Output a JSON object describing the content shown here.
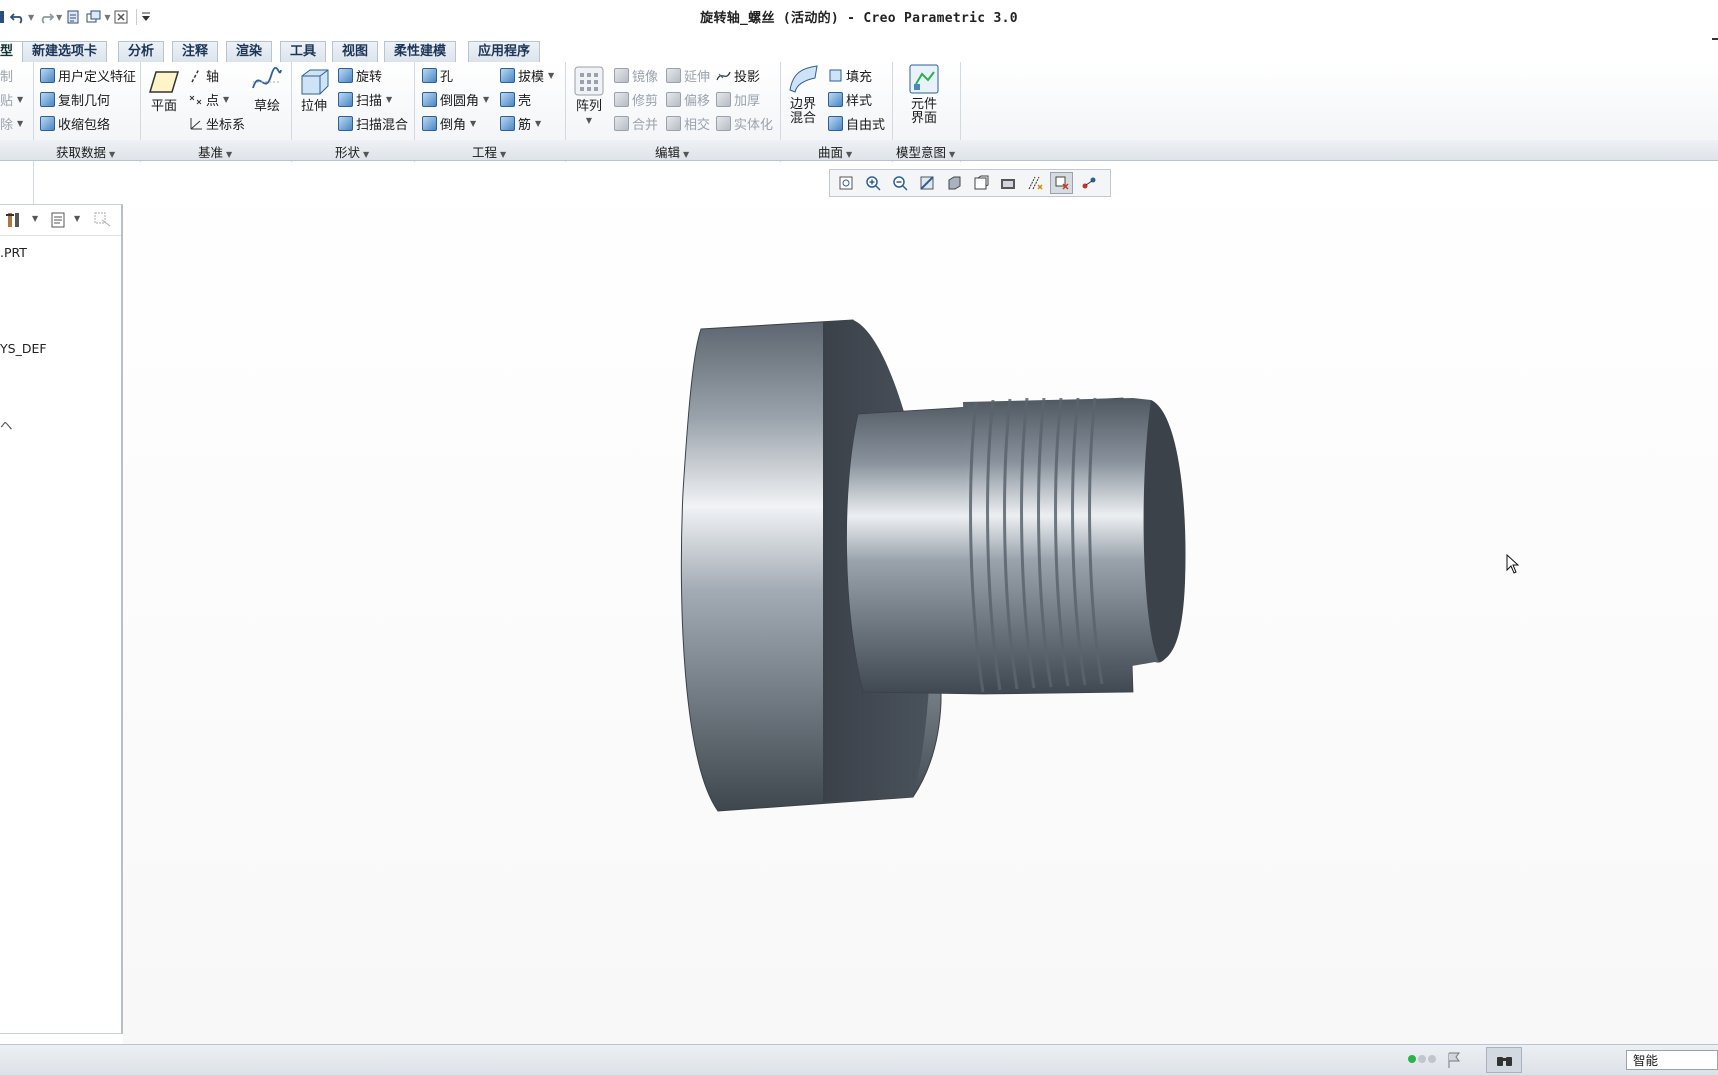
{
  "window": {
    "title": "旋转轴_螺丝 (活动的) - Creo Parametric 3.0"
  },
  "quick_access": {
    "icons": [
      "save-icon",
      "undo-icon",
      "redo-icon",
      "regenerate-icon",
      "windows-icon",
      "close-window-icon",
      "customize-icon"
    ]
  },
  "tabs": [
    "型",
    "新建选项卡",
    "分析",
    "注释",
    "渲染",
    "工具",
    "视图",
    "柔性建模",
    "应用程序"
  ],
  "ribbon": {
    "clipboard": {
      "copy": "制",
      "paste": "贴",
      "delete": "除"
    },
    "get_data": {
      "label": "获取数据",
      "udf": "用户定义特征",
      "copy_geom": "复制几何",
      "shrinkwrap": "收缩包络"
    },
    "datum": {
      "label": "基准",
      "plane": "平面",
      "axis": "轴",
      "point": "点",
      "csys": "坐标系",
      "sketch": "草绘"
    },
    "shape": {
      "label": "形状",
      "extrude": "拉伸",
      "revolve": "旋转",
      "sweep": "扫描",
      "swept_blend": "扫描混合"
    },
    "engineering": {
      "label": "工程",
      "hole": "孔",
      "round": "倒圆角",
      "chamfer": "倒角",
      "draft": "拔模",
      "shell": "壳",
      "rib": "筋"
    },
    "editing": {
      "label": "编辑",
      "pattern": "阵列",
      "mirror": "镜像",
      "trim": "修剪",
      "merge": "合并",
      "extend": "延伸",
      "offset": "偏移",
      "intersect": "相交",
      "project": "投影",
      "thicken": "加厚",
      "solidify": "实体化"
    },
    "surfaces": {
      "label": "曲面",
      "boundary_blend_1": "边界",
      "boundary_blend_2": "混合",
      "fill": "填充",
      "style": "样式",
      "freestyle": "自由式"
    },
    "model_intent": {
      "label": "模型意图",
      "component_interface_1": "元件",
      "component_interface_2": "界面"
    }
  },
  "view_toolbar": {
    "icons": [
      "refit-icon",
      "zoom-in-icon",
      "zoom-out-icon",
      "repaint-icon",
      "display-style-icon",
      "saved-orientations-icon",
      "view-manager-icon",
      "datum-display-icon",
      "spin-center-icon",
      "annotation-display-icon"
    ]
  },
  "model_tree": {
    "items": [
      ".PRT",
      "YS_DEF",
      "ヘ"
    ]
  },
  "status": {
    "filter": "智能"
  },
  "colors": {
    "tab_text": "#1d3557",
    "accent": "#2e5f95",
    "status_green": "#2bb24c",
    "model_metal": "#8a939e"
  }
}
